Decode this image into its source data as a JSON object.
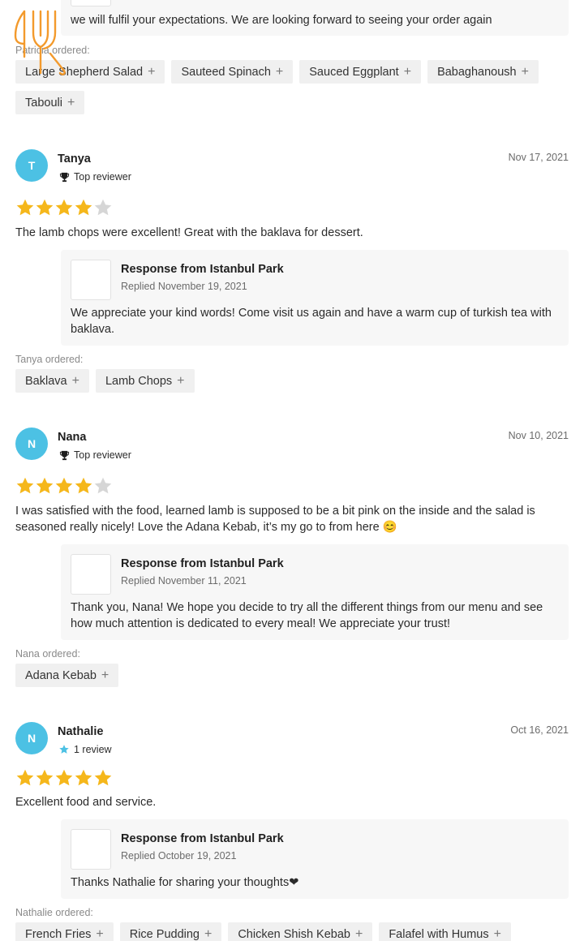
{
  "top": {
    "response_text": "we will fulfil your expectations. We are looking forward to seeing your order again",
    "ordered_label": "Patricia ordered:",
    "items": [
      "Large Shepherd Salad",
      "Sauteed Spinach",
      "Sauced Eggplant",
      "Babaghanoush",
      "Tabouli"
    ]
  },
  "colors": {
    "avatar": "#4cc1e4",
    "star_filled": "#f5b71b",
    "star_empty": "#d6d6d6",
    "logo": "#f39a2c"
  },
  "reviews": [
    {
      "initial": "T",
      "name": "Tanya",
      "badge": "Top reviewer",
      "badge_icon": "trophy-icon",
      "date": "Nov 17, 2021",
      "rating": 4,
      "comment": "The lamb chops were excellent! Great with the baklava for dessert.",
      "response_title": "Response from Istanbul Park",
      "response_date": "Replied November 19, 2021",
      "response_text": "We appreciate your kind words! Come visit us again and have a warm cup of turkish tea with baklava.",
      "ordered_label": "Tanya ordered:",
      "items": [
        "Baklava",
        "Lamb Chops"
      ]
    },
    {
      "initial": "N",
      "name": "Nana",
      "badge": "Top reviewer",
      "badge_icon": "trophy-icon",
      "date": "Nov 10, 2021",
      "rating": 4,
      "comment": "I was satisfied with the food, learned lamb is supposed to be a bit pink on the inside and the salad is seasoned really nicely! Love the Adana Kebab, it’s my go to from here 😊",
      "response_title": "Response from Istanbul Park",
      "response_date": "Replied November 11, 2021",
      "response_text": "Thank you, Nana! We hope you decide to try all the different things from our menu and see how much attention is dedicated to every meal! We appreciate your trust!",
      "ordered_label": "Nana ordered:",
      "items": [
        "Adana Kebab"
      ]
    },
    {
      "initial": "N",
      "name": "Nathalie",
      "badge": "1 review",
      "badge_icon": "star-icon",
      "date": "Oct 16, 2021",
      "rating": 5,
      "comment": "Excellent food and service.",
      "response_title": "Response from Istanbul Park",
      "response_date": "Replied October 19, 2021",
      "response_text": "Thanks Nathalie for sharing your thoughts❤",
      "ordered_label": "Nathalie ordered:",
      "items": [
        "French Fries",
        "Rice Pudding",
        "Chicken Shish Kebab",
        "Falafel with Humus"
      ]
    }
  ]
}
